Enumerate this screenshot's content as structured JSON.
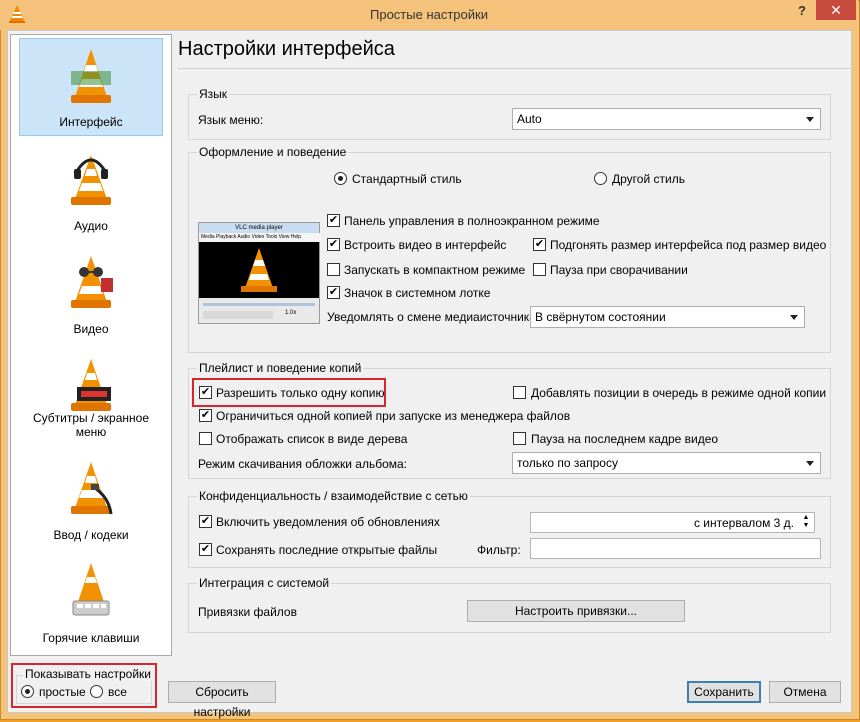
{
  "window": {
    "title": "Простые настройки",
    "help_label": "?",
    "close_label": "✕"
  },
  "sidebar": {
    "items": [
      {
        "label": "Интерфейс",
        "icon": "vlc-cone-interface-icon",
        "selected": true
      },
      {
        "label": "Аудио",
        "icon": "vlc-cone-headphones-icon"
      },
      {
        "label": "Видео",
        "icon": "vlc-cone-glasses-icon"
      },
      {
        "label": "Субтитры / экранное меню",
        "icon": "vlc-cone-subtitle-icon"
      },
      {
        "label": "Ввод / кодеки",
        "icon": "vlc-cone-cable-icon"
      },
      {
        "label": "Горячие клавиши",
        "icon": "vlc-cone-keyboard-icon"
      }
    ]
  },
  "header": {
    "title": "Настройки интерфейса"
  },
  "language": {
    "legend": "Язык",
    "menu_label": "Язык меню:",
    "menu_value": "Auto"
  },
  "look": {
    "legend": "Оформление и поведение",
    "style_native": "Стандартный стиль",
    "style_custom": "Другой стиль",
    "preview_title": "VLC media player",
    "preview_menu": "Media Playback Audio Video Tools View Help",
    "preview_time": "1.0x",
    "fullscreen_controller": "Панель управления в полноэкранном режиме",
    "embed_video": "Встроить видео в интерфейс",
    "resize_interface": "Подгонять размер интерфейса под размер видео",
    "minimal_view": "Запускать в компактном режиме",
    "pause_minimized": "Пауза при сворачивании",
    "systray_icon": "Значок в системном лотке",
    "notify_label": "Уведомлять о смене медиаисточника:",
    "notify_value": "В свёрнутом состоянии"
  },
  "playlist": {
    "legend": "Плейлист и поведение копий",
    "one_instance": "Разрешить только одну копию",
    "enqueue_one": "Добавлять позиции в очередь в режиме одной копии",
    "one_instance_fm": "Ограничиться одной копией при запуске из менеджера файлов",
    "tree_view": "Отображать список в виде дерева",
    "pause_last_frame": "Пауза на последнем кадре видео",
    "art_label": "Режим скачивания обложки альбома:",
    "art_value": "только по запросу"
  },
  "privacy": {
    "legend": "Конфиденциальность / взаимодействие с сетью",
    "updates": "Включить уведомления об обновлениях",
    "interval_value": "с интервалом 3 д.",
    "recent": "Сохранять последние открытые файлы",
    "filter_label": "Фильтр:",
    "filter_value": ""
  },
  "integration": {
    "legend": "Интеграция с системой",
    "assoc_label": "Привязки файлов",
    "assoc_button": "Настроить привязки..."
  },
  "show_settings": {
    "legend": "Показывать настройки",
    "simple": "простые",
    "all": "все"
  },
  "buttons": {
    "reset": "Сбросить настройки",
    "save": "Сохранить",
    "cancel": "Отмена"
  },
  "checks": {
    "fullscreen_controller": "✔",
    "embed_video": "✔",
    "resize_interface": "✔",
    "systray_icon": "✔",
    "one_instance": "✔",
    "one_instance_fm": "✔",
    "updates": "✔",
    "recent": "✔"
  },
  "colors": {
    "accent_red": "#d4262d",
    "window_frame": "#f3c47a",
    "selection": "#cce4f7"
  }
}
